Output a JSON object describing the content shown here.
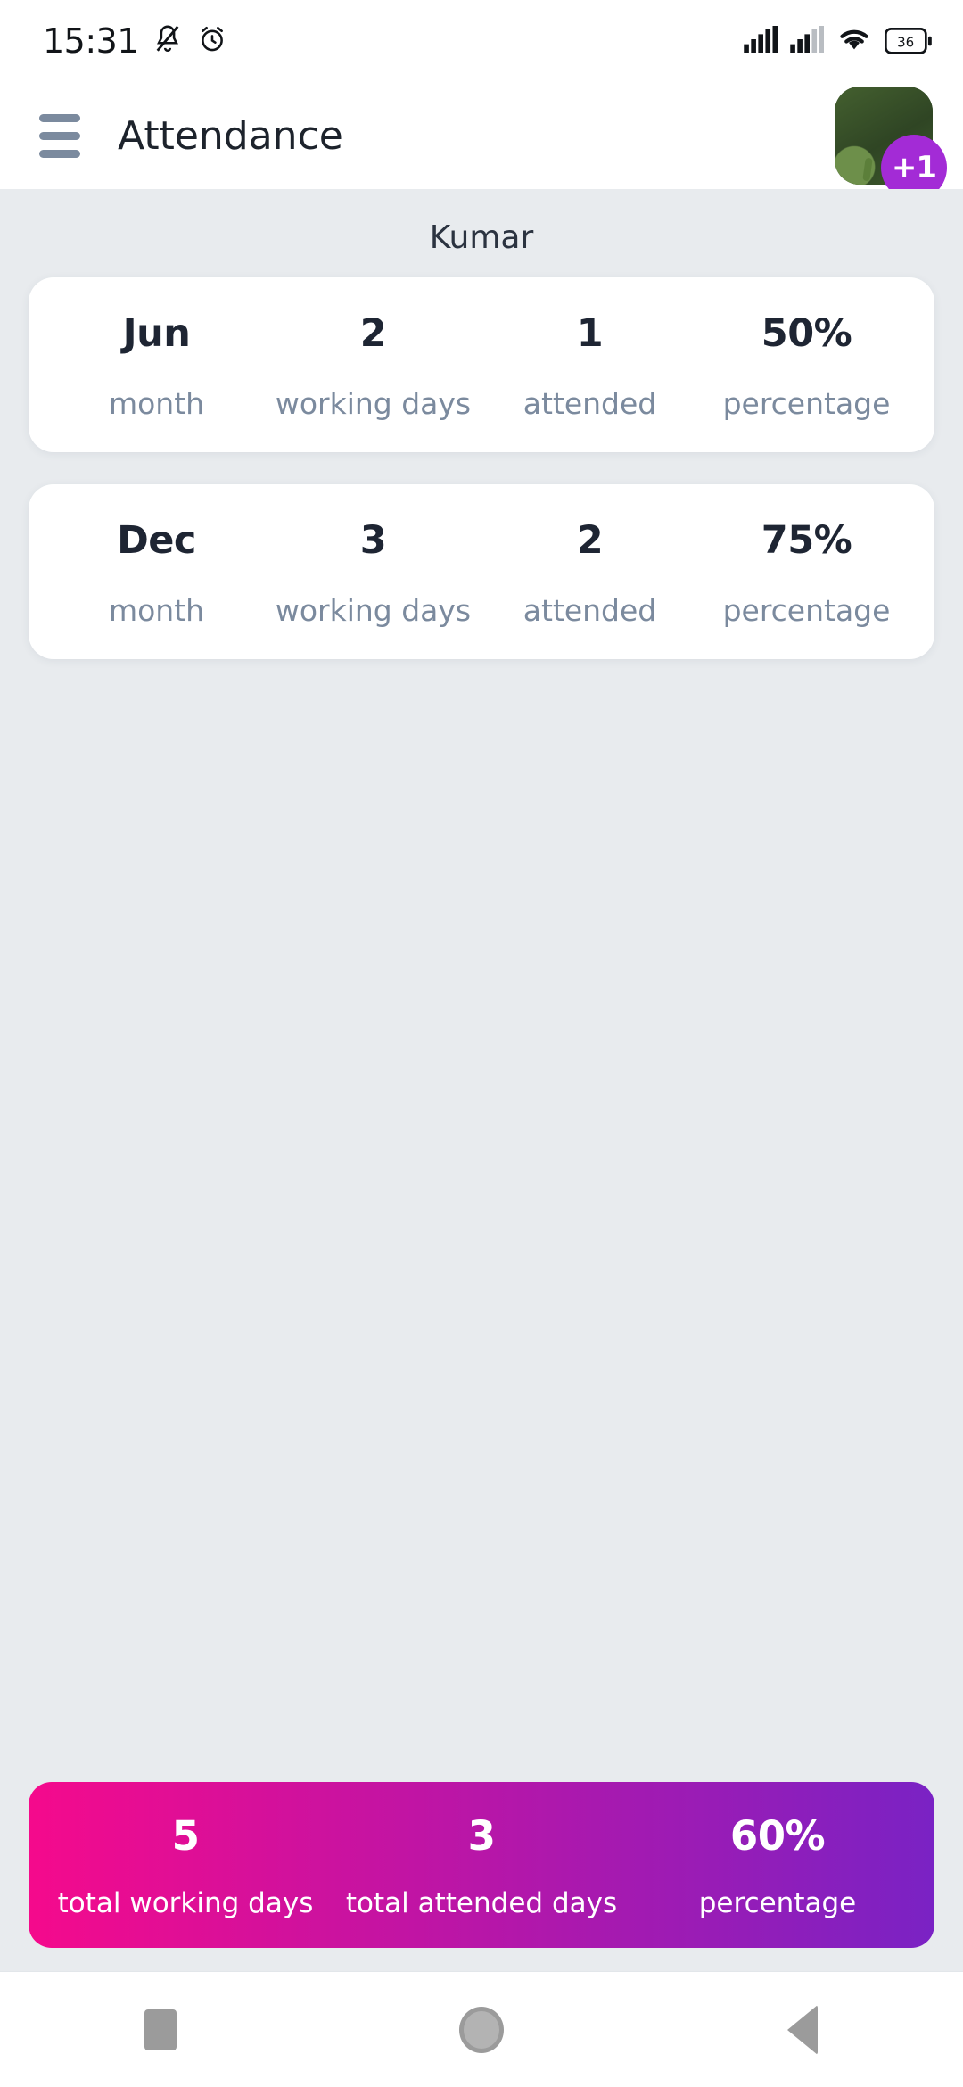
{
  "status_bar": {
    "time": "15:31",
    "icons": [
      "bell-mute-icon",
      "alarm-clock-icon",
      "signal-bars-icon",
      "signal-bars-2-icon",
      "wifi-icon",
      "battery-icon"
    ],
    "battery_level": "36"
  },
  "app_bar": {
    "menu_icon": "hamburger-menu-icon",
    "title": "Attendance",
    "avatar_icon": "rose-avatar-image",
    "badge": "+1"
  },
  "main": {
    "person_name": "Kumar",
    "column_labels": {
      "month": "month",
      "working_days": "working days",
      "attended": "attended",
      "percentage": "percentage"
    },
    "records": [
      {
        "month": "Jun",
        "working_days": "2",
        "attended": "1",
        "percentage": "50%"
      },
      {
        "month": "Dec",
        "working_days": "3",
        "attended": "2",
        "percentage": "75%"
      }
    ]
  },
  "totals": {
    "working_days_value": "5",
    "working_days_label": "total working days",
    "attended_value": "3",
    "attended_label": "total attended days",
    "percentage_value": "60%",
    "percentage_label": "percentage",
    "gradient_start": "#f50a8c",
    "gradient_end": "#7a22c4"
  },
  "nav_bar": {
    "recents_icon": "square-recents-icon",
    "home_icon": "circle-home-icon",
    "back_icon": "triangle-back-icon"
  },
  "colors": {
    "background": "#e8ebee",
    "card": "#ffffff",
    "value_text": "#1e2533",
    "label_text": "#7b8a9e",
    "badge": "#a32bd6"
  }
}
